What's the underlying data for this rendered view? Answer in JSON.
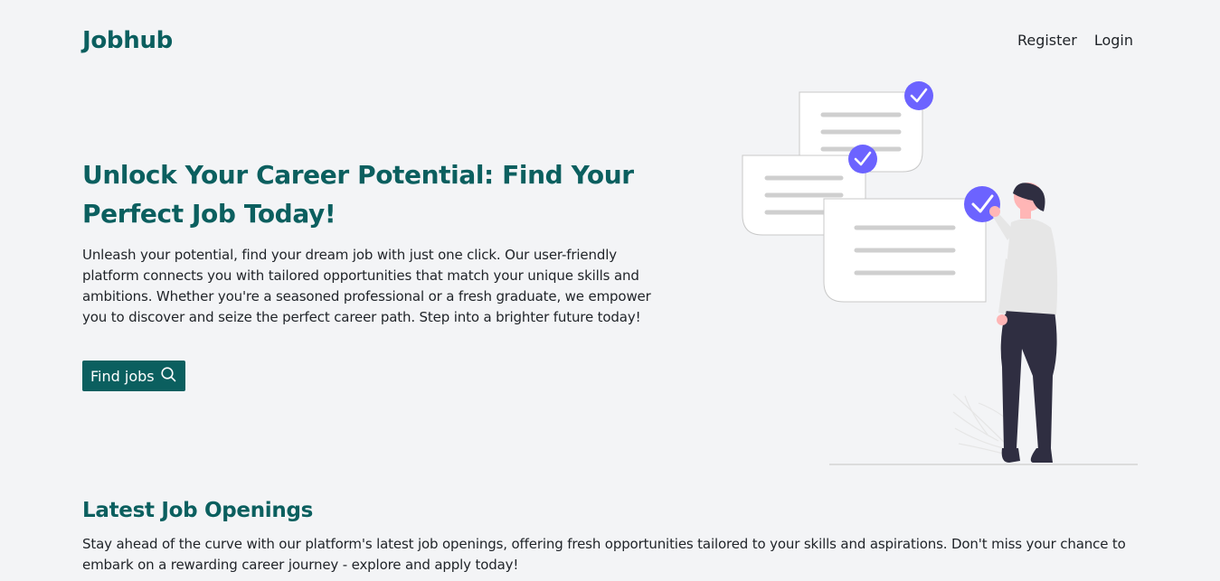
{
  "header": {
    "brand": "Jobhub",
    "nav": {
      "register": "Register",
      "login": "Login"
    }
  },
  "hero": {
    "title": "Unlock Your Career Potential: Find Your Perfect Job Today!",
    "description": "Unleash your potential, find your dream job with just one click. Our user-friendly platform connects you with tailored opportunities that match your unique skills and ambitions. Whether you're a seasoned professional or a fresh graduate, we empower you to discover and seize the perfect career path. Step into a brighter future today!",
    "button_label": "Find jobs",
    "button_icon": "search-icon"
  },
  "illustration": {
    "name": "person-checking-documents-illustration"
  },
  "latest": {
    "title": "Latest Job Openings",
    "description": "Stay ahead of the curve with our platform's latest job openings, offering fresh opportunities tailored to your skills and aspirations. Don't miss your chance to embark on a rewarding career journey - explore and apply today!"
  },
  "colors": {
    "brand": "#0b5f5f",
    "background": "#f3f4f6",
    "accent": "#6c63ff"
  }
}
